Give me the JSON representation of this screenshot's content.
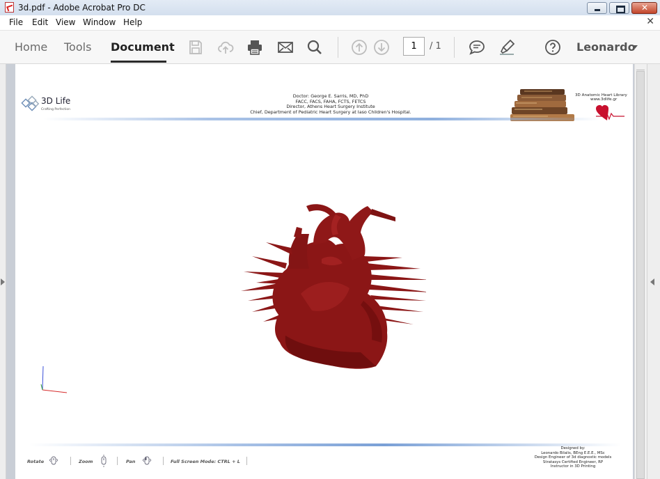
{
  "window": {
    "title": "3d.pdf - Adobe Acrobat Pro DC",
    "close_glyph": "✕"
  },
  "menu": {
    "items": [
      "File",
      "Edit",
      "View",
      "Window",
      "Help"
    ],
    "close_glyph": "✕"
  },
  "toolbar": {
    "tabs": [
      "Home",
      "Tools",
      "Document"
    ],
    "active_tab": "Document",
    "icons": [
      "save-icon",
      "cloud-upload-icon",
      "print-icon",
      "mail-icon",
      "search-icon",
      "page-up-icon",
      "page-down-icon",
      "comment-icon",
      "highlight-pen-icon",
      "help-icon"
    ],
    "page_current": "1",
    "page_total": "/ 1",
    "user": "Leonardo"
  },
  "document": {
    "logo_name": "3D Life",
    "logo_tagline": "Crafting Perfection",
    "header_lines": [
      "Doctor: George E. Sarris, MD, PhD",
      "FACC, FACS, FAHA, FCTS, FETCS",
      "Director, Athens Heart Surgery Institute",
      "Chief, Department of Pediatric Heart Surgery at Iaso Children's Hospital."
    ],
    "library_title": "3D Anatomic Heart Library",
    "library_url": "www.3dlife.gr",
    "controls": [
      "Rotate",
      "Zoom",
      "Pan",
      "Full Screen Mode:  CTRL + L"
    ],
    "credits": [
      "Designed by:",
      "Leonardo Bilalis, BEng E.E.E., MSc",
      "Design Engineer of 3d diagnostic models",
      "Stratasys Certified Engineer, RP",
      "Instructor in 3D Printing"
    ],
    "model_color": "#8b1616"
  }
}
